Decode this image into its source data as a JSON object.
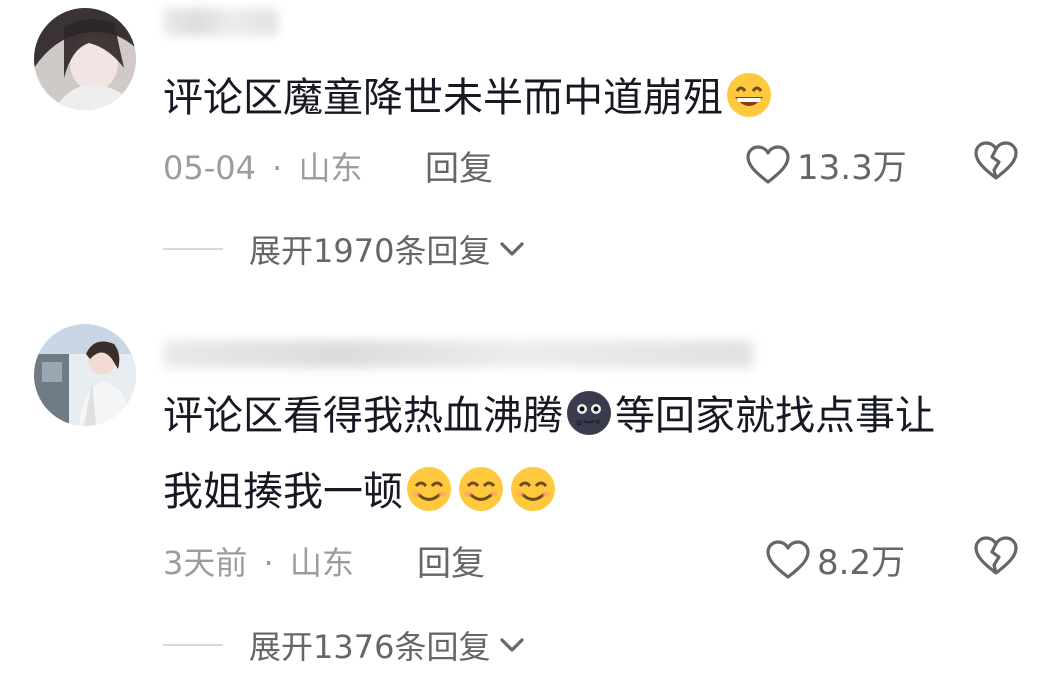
{
  "comments": [
    {
      "text_before": "评论区魔童降世未半而中道崩殂",
      "text_after": "",
      "text_line2": "",
      "emoji_count_line1": 1,
      "emoji_count_line2": 0,
      "date": "05-04",
      "separator": "·",
      "location": "山东",
      "reply_label": "回复",
      "likes": "13.3万",
      "expand_label": "展开1970条回复"
    },
    {
      "text_before": "评论区看得我热血沸腾",
      "text_after": "等回家就找点事让",
      "text_line2": "我姐揍我一顿",
      "emoji_count_line1": 1,
      "emoji_count_line2": 3,
      "date": "3天前",
      "separator": "·",
      "location": "山东",
      "reply_label": "回复",
      "likes": "8.2万",
      "expand_label": "展开1376条回复"
    }
  ],
  "colors": {
    "text": "#161823",
    "meta": "#9c9c9c",
    "action": "#666666",
    "emoji": "#FFC83D"
  },
  "icons": [
    "heart-outline-icon",
    "broken-heart-icon",
    "chevron-down-icon",
    "grinning-emoji-icon",
    "dark-moon-emoji-icon",
    "smiling-emoji-icon"
  ]
}
